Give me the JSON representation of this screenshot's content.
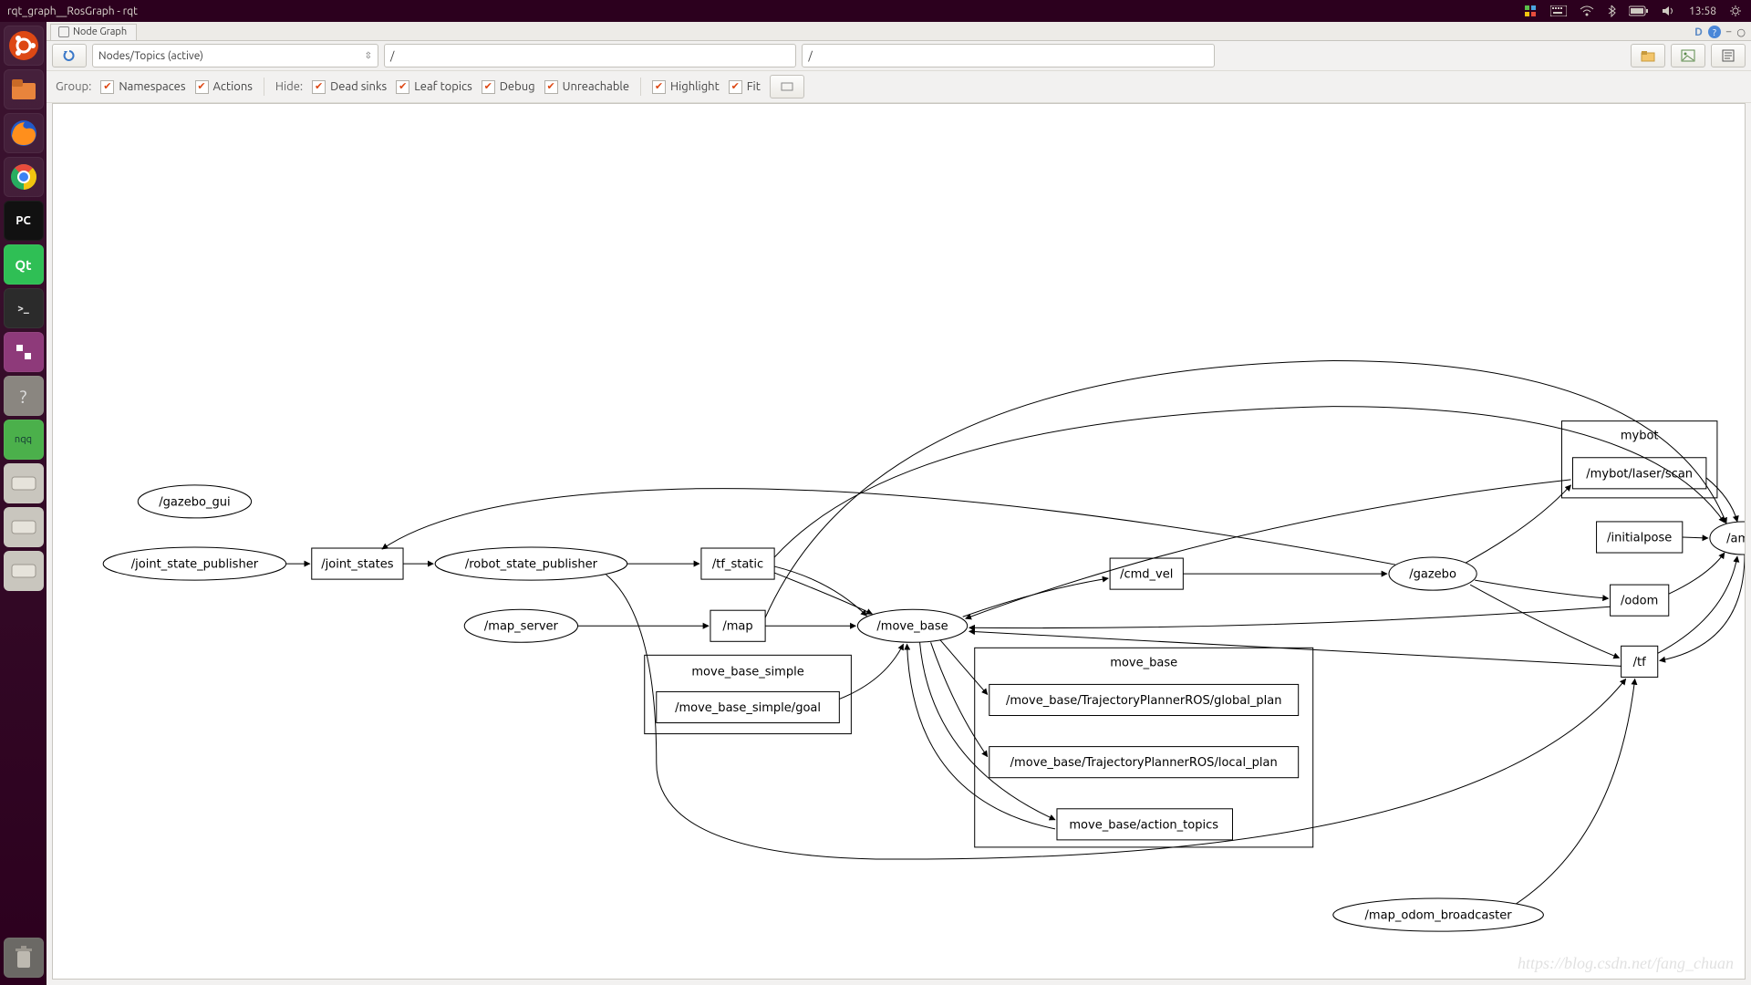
{
  "topbar": {
    "title": "rqt_graph__RosGraph - rqt",
    "clock": "13:58"
  },
  "tab": {
    "title": "Node Graph",
    "right_label": "D"
  },
  "toolbar": {
    "filter_mode": "Nodes/Topics (active)",
    "filter1": "/",
    "filter2": "/"
  },
  "options": {
    "group_label": "Group:",
    "hide_label": "Hide:",
    "namespaces": "Namespaces",
    "actions": "Actions",
    "dead_sinks": "Dead sinks",
    "leaf_topics": "Leaf topics",
    "debug": "Debug",
    "unreachable": "Unreachable",
    "highlight": "Highlight",
    "fit": "Fit"
  },
  "graph": {
    "nodes": {
      "gazebo_gui": "/gazebo_gui",
      "joint_state_publisher": "/joint_state_publisher",
      "joint_states": "/joint_states",
      "robot_state_publisher": "/robot_state_publisher",
      "map_server": "/map_server",
      "tf_static": "/tf_static",
      "map": "/map",
      "move_base": "/move_base",
      "cmd_vel": "/cmd_vel",
      "gazebo": "/gazebo",
      "amcl": "/amcl",
      "initialpose": "/initialpose",
      "odom": "/odom",
      "tf": "/tf",
      "mybot_group": "mybot",
      "mybot_laser_scan": "/mybot/laser/scan",
      "move_base_simple_group": "move_base_simple",
      "move_base_simple_goal": "/move_base_simple/goal",
      "move_base_group": "move_base",
      "mb_global": "/move_base/TrajectoryPlannerROS/global_plan",
      "mb_local": "/move_base/TrajectoryPlannerROS/local_plan",
      "mb_action": "move_base/action_topics",
      "map_odom_broadcaster": "/map_odom_broadcaster"
    }
  },
  "watermark": "https://blog.csdn.net/fang_chuan"
}
